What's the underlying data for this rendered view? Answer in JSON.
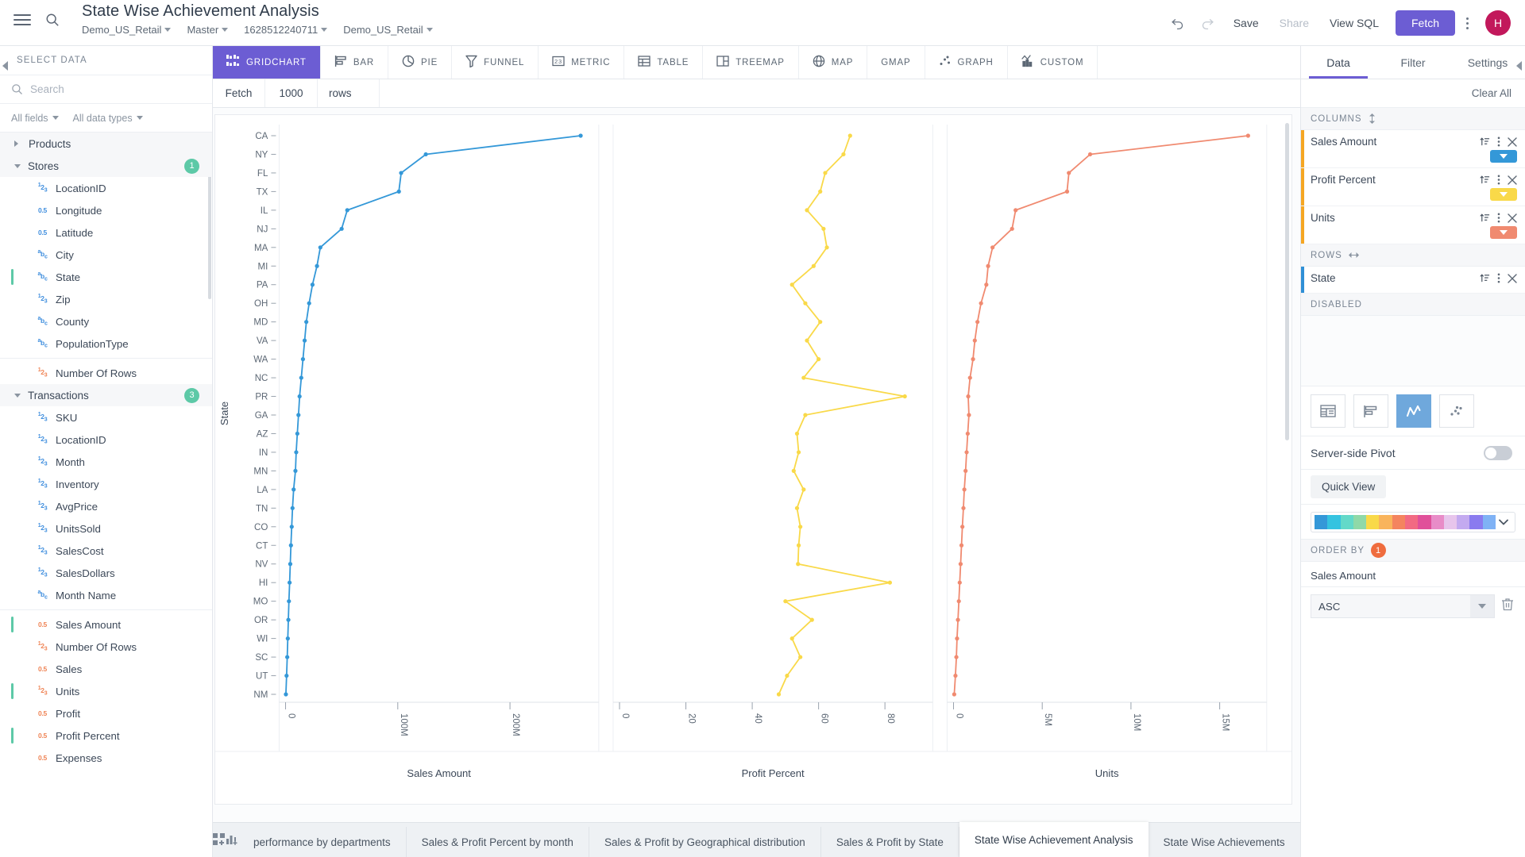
{
  "header": {
    "title": "State Wise Achievement Analysis",
    "crumbs": [
      "Demo_US_Retail",
      "Master",
      "1628512240711",
      "Demo_US_Retail"
    ],
    "undo_icon": "undo-icon",
    "redo_icon": "redo-icon",
    "save_label": "Save",
    "share_label": "Share",
    "view_sql_label": "View SQL",
    "fetch_label": "Fetch",
    "avatar_initial": "H",
    "menu_icon": "hamburger-icon",
    "search_icon": "search-icon"
  },
  "left_panel": {
    "title": "SELECT DATA",
    "search_placeholder": "Search",
    "search_value": "",
    "filter_fields": "All fields",
    "filter_types": "All data types",
    "groups": [
      {
        "name": "Products",
        "expanded": false,
        "badge": null,
        "fields": []
      },
      {
        "name": "Stores",
        "expanded": true,
        "badge": "1",
        "fields": [
          {
            "label": "LocationID",
            "type": "123",
            "selected": false
          },
          {
            "label": "Longitude",
            "type": "0.5",
            "selected": false
          },
          {
            "label": "Latitude",
            "type": "0.5",
            "selected": false
          },
          {
            "label": "City",
            "type": "abc",
            "selected": false
          },
          {
            "label": "State",
            "type": "abc",
            "selected": true
          },
          {
            "label": "Zip",
            "type": "123",
            "selected": false
          },
          {
            "label": "County",
            "type": "abc",
            "selected": false
          },
          {
            "label": "PopulationType",
            "type": "abc",
            "selected": false
          }
        ]
      },
      {
        "name": "__divider__",
        "expanded": true,
        "badge": null,
        "fields": [
          {
            "label": "Number Of Rows",
            "type": "123",
            "measure": true,
            "selected": false
          }
        ]
      },
      {
        "name": "Transactions",
        "expanded": true,
        "badge": "3",
        "fields": [
          {
            "label": "SKU",
            "type": "123",
            "selected": false
          },
          {
            "label": "LocationID",
            "type": "123",
            "selected": false
          },
          {
            "label": "Month",
            "type": "123",
            "selected": false
          },
          {
            "label": "Inventory",
            "type": "123",
            "selected": false
          },
          {
            "label": "AvgPrice",
            "type": "123",
            "selected": false
          },
          {
            "label": "UnitsSold",
            "type": "123",
            "selected": false
          },
          {
            "label": "SalesCost",
            "type": "123",
            "selected": false
          },
          {
            "label": "SalesDollars",
            "type": "123",
            "selected": false
          },
          {
            "label": "Month Name",
            "type": "abc",
            "selected": false
          }
        ]
      },
      {
        "name": "__divider2__",
        "expanded": true,
        "badge": null,
        "fields": [
          {
            "label": "Sales Amount",
            "type": "0.5",
            "measure": true,
            "selected": true
          },
          {
            "label": "Number Of Rows",
            "type": "123",
            "measure": true,
            "selected": false
          },
          {
            "label": "Sales",
            "type": "0.5",
            "measure": true,
            "selected": false
          },
          {
            "label": "Units",
            "type": "123",
            "measure": true,
            "selected": true
          },
          {
            "label": "Profit",
            "type": "0.5",
            "measure": true,
            "selected": false
          },
          {
            "label": "Profit Percent",
            "type": "0.5",
            "measure": true,
            "selected": true
          },
          {
            "label": "Expenses",
            "type": "0.5",
            "measure": true,
            "selected": false
          }
        ]
      }
    ]
  },
  "chart_types": [
    {
      "label": "GRIDCHART",
      "icon": "gridchart-icon",
      "active": true
    },
    {
      "label": "BAR",
      "icon": "bar-icon",
      "active": false
    },
    {
      "label": "PIE",
      "icon": "pie-icon",
      "active": false
    },
    {
      "label": "FUNNEL",
      "icon": "funnel-icon",
      "active": false
    },
    {
      "label": "METRIC",
      "icon": "metric-icon",
      "active": false
    },
    {
      "label": "TABLE",
      "icon": "table-icon",
      "active": false
    },
    {
      "label": "TREEMAP",
      "icon": "treemap-icon",
      "active": false
    },
    {
      "label": "MAP",
      "icon": "map-icon",
      "active": false
    },
    {
      "label": "GMAP",
      "icon": "gmap-icon",
      "active": false
    },
    {
      "label": "GRAPH",
      "icon": "graph-icon",
      "active": false
    },
    {
      "label": "CUSTOM",
      "icon": "custom-icon",
      "active": false
    }
  ],
  "fetch_row": {
    "fetch_label": "Fetch",
    "rows_value": "1000",
    "rows_label": "rows"
  },
  "right_panel": {
    "tabs": [
      {
        "label": "Data",
        "active": true
      },
      {
        "label": "Filter",
        "active": false
      },
      {
        "label": "Settings",
        "active": false
      }
    ],
    "clear_all": "Clear All",
    "columns_header": "COLUMNS",
    "columns": [
      {
        "name": "Sales Amount",
        "color": "#3498d8",
        "accent": "#f5a623"
      },
      {
        "name": "Profit Percent",
        "color": "#f8d council",
        "accent": "#f5a623"
      },
      {
        "name": "Units",
        "color": "#f08a70",
        "accent": "#f5a623"
      }
    ],
    "rows_header": "ROWS",
    "rows": [
      {
        "name": "State",
        "accent": "#2f8fd6"
      }
    ],
    "disabled_header": "DISABLED",
    "viz_buttons": [
      {
        "icon": "grid-table-icon",
        "active": false
      },
      {
        "icon": "bar-viz-icon",
        "active": false
      },
      {
        "icon": "line-viz-icon",
        "active": true
      },
      {
        "icon": "scatter-viz-icon",
        "active": false
      }
    ],
    "server_pivot_label": "Server-side Pivot",
    "server_pivot_on": false,
    "quick_view_label": "Quick View",
    "palette": [
      "#3498d8",
      "#35c3e0",
      "#63d9c9",
      "#8fd9a8",
      "#f9d949",
      "#f9b45c",
      "#f4845f",
      "#f26a83",
      "#e0509a",
      "#e88cc8",
      "#e7c5ec",
      "#c3aaf0",
      "#8a7bef",
      "#7fb2f5"
    ],
    "order_by_header": "ORDER BY",
    "order_by_count": "1",
    "order_by_field": "Sales Amount",
    "order_by_dir": "ASC"
  },
  "bottom_tabs": [
    {
      "label": "performance by departments",
      "active": false
    },
    {
      "label": "Sales & Profit Percent by month",
      "active": false
    },
    {
      "label": "Sales & Profit by Geographical distribution",
      "active": false
    },
    {
      "label": "Sales & Profit by State",
      "active": false
    },
    {
      "label": "State Wise Achievement Analysis",
      "active": true
    },
    {
      "label": "State Wise Achievements",
      "active": false
    }
  ],
  "chart_data": {
    "type": "line",
    "title": "",
    "layout": "grid of 3 horizontally-faceted line charts sharing a categorical y-axis",
    "orientation": "horizontal",
    "ylabel": "State",
    "grid": false,
    "legend": "none",
    "categories": [
      "CA",
      "NY",
      "FL",
      "TX",
      "IL",
      "NJ",
      "MA",
      "MI",
      "PA",
      "OH",
      "MD",
      "VA",
      "WA",
      "NC",
      "PR",
      "GA",
      "AZ",
      "IN",
      "MN",
      "LA",
      "TN",
      "CO",
      "CT",
      "NV",
      "HI",
      "MO",
      "OR",
      "WI",
      "SC",
      "UT",
      "NM"
    ],
    "panels": [
      {
        "name": "Sales Amount",
        "xlabel": "Sales Amount",
        "color": "#3498d8",
        "xlim": [
          0,
          272000000
        ],
        "xticks": [
          0,
          100000000,
          200000000
        ],
        "xticklabels": [
          "0",
          "100M",
          "200M"
        ],
        "values": [
          263000000,
          125000000,
          103000000,
          101000000,
          55000000,
          50000000,
          31000000,
          28000000,
          24000000,
          21000000,
          18500000,
          17000000,
          15500000,
          14000000,
          12500000,
          11500000,
          10500000,
          9500000,
          8800000,
          7200000,
          6200000,
          5500000,
          4800000,
          4200000,
          3600000,
          3000000,
          2500000,
          2000000,
          1500000,
          900000,
          300000
        ]
      },
      {
        "name": "Profit Percent",
        "xlabel": "Profit Percent",
        "color": "#f9d949",
        "xlim": [
          0,
          92
        ],
        "xticks": [
          0,
          20,
          40,
          60,
          80
        ],
        "xticklabels": [
          "0",
          "20",
          "40",
          "60",
          "80"
        ],
        "values": [
          69.5,
          67.5,
          62.0,
          60.5,
          56.5,
          61.5,
          62.5,
          58.5,
          52.0,
          56.0,
          60.5,
          56.5,
          60.0,
          55.5,
          86.0,
          56.0,
          53.5,
          54.0,
          52.5,
          55.5,
          53.5,
          54.5,
          54.0,
          53.8,
          81.5,
          50.0,
          58.0,
          52.0,
          54.5,
          50.5,
          48.0
        ]
      },
      {
        "name": "Units",
        "xlabel": "Units",
        "color": "#f08a70",
        "xlim": [
          0,
          17200000
        ],
        "xticks": [
          0,
          5000000,
          10000000,
          15000000
        ],
        "xticklabels": [
          "0",
          "5M",
          "10M",
          "15M"
        ],
        "values": [
          16600000,
          7700000,
          6500000,
          6400000,
          3500000,
          3300000,
          2200000,
          1950000,
          1850000,
          1550000,
          1350000,
          1200000,
          1100000,
          930000,
          830000,
          870000,
          800000,
          740000,
          680000,
          610000,
          560000,
          500000,
          450000,
          400000,
          350000,
          300000,
          250000,
          200000,
          160000,
          110000,
          40000
        ]
      }
    ]
  }
}
